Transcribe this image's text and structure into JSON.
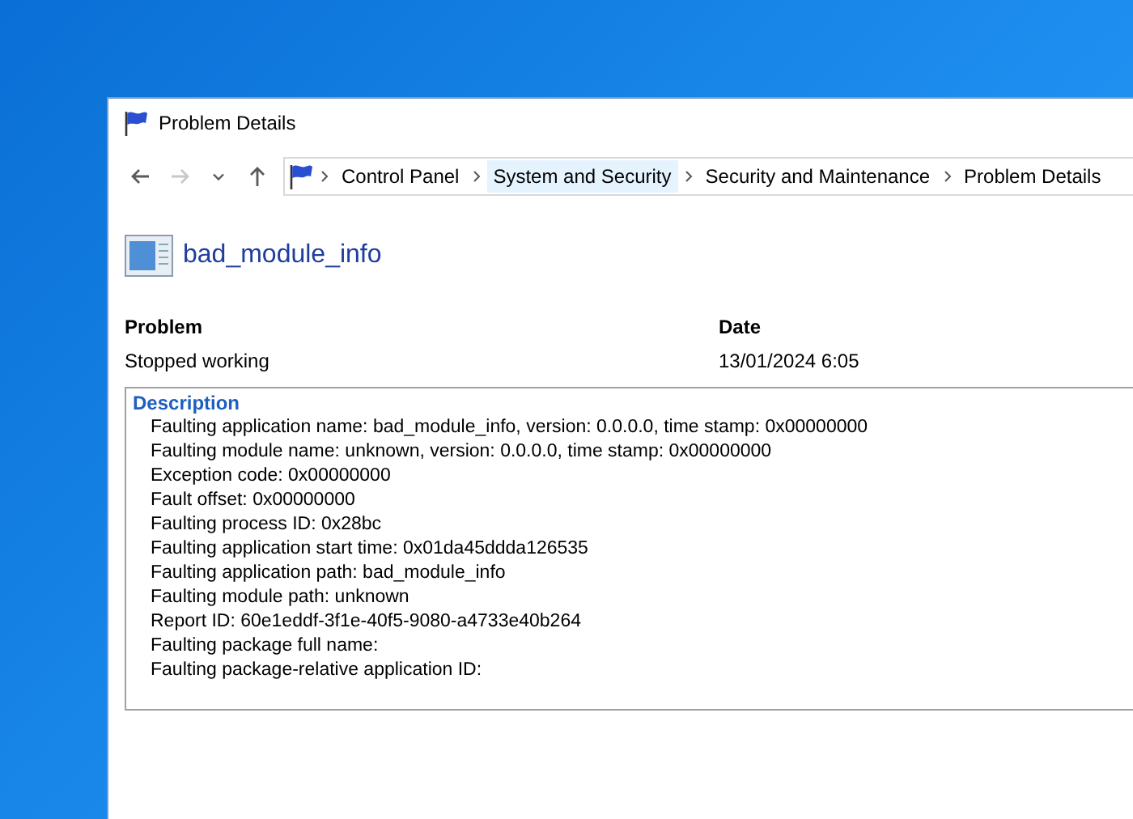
{
  "window": {
    "title": "Problem Details"
  },
  "nav": [
    {
      "kind": "back",
      "disabled": false
    },
    {
      "kind": "forward",
      "disabled": true
    },
    {
      "kind": "recent",
      "disabled": false
    },
    {
      "kind": "up",
      "disabled": false
    }
  ],
  "breadcrumb": [
    {
      "label": "Control Panel",
      "highlighted": false
    },
    {
      "label": "System and Security",
      "highlighted": true
    },
    {
      "label": "Security and Maintenance",
      "highlighted": false
    },
    {
      "label": "Problem Details",
      "highlighted": false
    }
  ],
  "heading": "bad_module_info",
  "table": {
    "columns": [
      "Problem",
      "Date"
    ],
    "rows": [
      [
        "Stopped working",
        "13/01/2024 6:05"
      ]
    ]
  },
  "description": {
    "title": "Description",
    "lines": [
      "Faulting application name: bad_module_info, version: 0.0.0.0, time stamp: 0x00000000",
      "Faulting module name: unknown, version: 0.0.0.0, time stamp: 0x00000000",
      "Exception code: 0x00000000",
      "Fault offset: 0x00000000",
      "Faulting process ID: 0x28bc",
      "Faulting application start time: 0x01da45ddda126535",
      "Faulting application path: bad_module_info",
      "Faulting module path: unknown",
      "Report ID: 60e1eddf-3f1e-40f5-9080-a4733e40b264",
      "Faulting package full name:",
      "Faulting package-relative application ID:"
    ]
  }
}
